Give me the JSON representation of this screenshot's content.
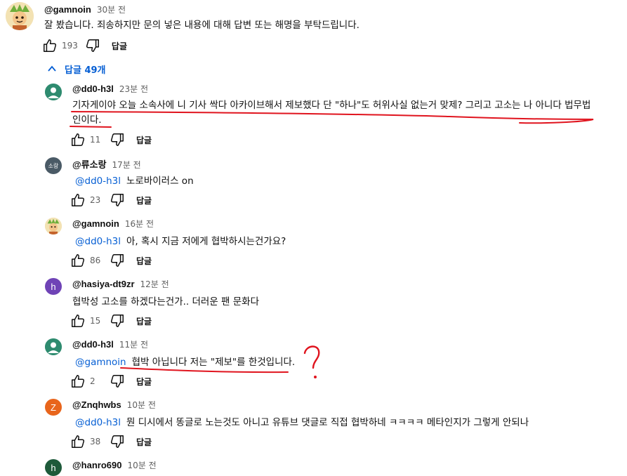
{
  "top_comment": {
    "author": "@gamnoin",
    "time": "30분 전",
    "text": "잘 봤습니다. 죄송하지만 문의 넣은 내용에 대해 답변 또는 해명을 부탁드립니다.",
    "likes": "193",
    "reply_label": "답글"
  },
  "replies_toggle": {
    "label": "답글 49개",
    "icon": "chevron-up-icon"
  },
  "replies": [
    {
      "author": "@dd0-h3l",
      "time": "23분 전",
      "avatar": {
        "letter": "",
        "color": "#2e8b6f"
      },
      "mention": "",
      "text_line1": "기자게이야 오늘 소속사에 니 기사 싹다 아카이브해서 제보했다 단 \"하나\"도 허위사실 없는거 맞제? 그리고 고소는 나 아니다 법무법",
      "text_line2": "인이다.",
      "likes": "11",
      "reply_label": "답글"
    },
    {
      "author": "@류소랑",
      "time": "17분 전",
      "avatar": {
        "letter": "소랑",
        "color": "#4a5a66"
      },
      "mention": "@dd0-h3l",
      "text": "노로바이러스 on",
      "likes": "23",
      "reply_label": "답글"
    },
    {
      "author": "@gamnoin",
      "time": "16분 전",
      "avatar": {
        "letter": "",
        "color": "#e9d6a4"
      },
      "mention": "@dd0-h3l",
      "text": "아, 혹시 지금 저에게 협박하시는건가요?",
      "likes": "86",
      "reply_label": "답글"
    },
    {
      "author": "@hasiya-dt9zr",
      "time": "12분 전",
      "avatar": {
        "letter": "h",
        "color": "#6f43b6"
      },
      "mention": "",
      "text": "협박성 고소를 하겠다는건가.. 더러운 팬 문화다",
      "likes": "15",
      "reply_label": "답글"
    },
    {
      "author": "@dd0-h3l",
      "time": "11분 전",
      "avatar": {
        "letter": "",
        "color": "#2e8b6f"
      },
      "mention": "@gamnoin",
      "text": "협박 아닙니다 저는 \"제보\"를 한것입니다.",
      "likes": "2",
      "reply_label": "답글"
    },
    {
      "author": "@Znqhwbs",
      "time": "10분 전",
      "avatar": {
        "letter": "Z",
        "color": "#e8651c"
      },
      "mention": "@dd0-h3l",
      "text": "뭔 디시에서 똥글로 노는것도 아니고 유튜브 댓글로 직접 협박하네 ㅋㅋㅋㅋ 메타인지가 그렇게 안되나",
      "likes": "38",
      "reply_label": "답글"
    },
    {
      "author": "@hanro690",
      "time": "10분 전",
      "avatar": {
        "letter": "h",
        "color": "#1e5a3a"
      },
      "mention": "",
      "text": ""
    }
  ],
  "annotation": {
    "color": "#e0141e",
    "mark": "?"
  }
}
